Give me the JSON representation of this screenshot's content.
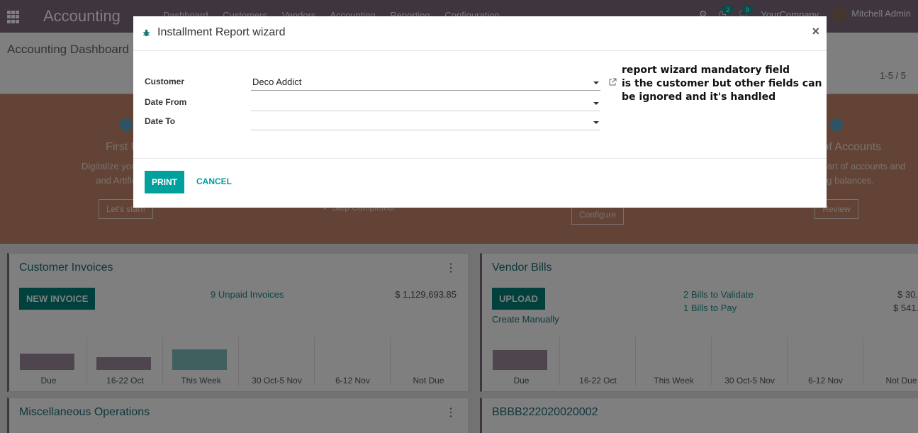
{
  "app": {
    "title": "Accounting",
    "menu": [
      "Dashboard",
      "Customers",
      "Vendors",
      "Accounting",
      "Reporting",
      "Configuration"
    ],
    "activity_count": "2",
    "message_count": "9",
    "company": "YourCompany",
    "user": "Mitchell Admin"
  },
  "control_panel": {
    "breadcrumb": "Accounting Dashboard",
    "pager": "1-5 / 5"
  },
  "onboarding": {
    "steps": [
      {
        "title": "First Bill",
        "desc1": "Digitalize your vendor",
        "desc2": "and Artificial In",
        "button": "Let's start!"
      },
      {
        "title": "",
        "desc1": "",
        "desc2": "",
        "button": "Configure"
      },
      {
        "title": "Chart of Accounts",
        "desc1": "Set up your chart of accounts and",
        "desc2": "opening balances.",
        "button": "Review"
      }
    ],
    "completed": "✓ Step Completed!"
  },
  "cards": {
    "customer_invoices": {
      "title": "Customer Invoices",
      "button": "NEW INVOICE",
      "link": "9 Unpaid Invoices",
      "amount": "$ 1,129,693.85",
      "graph_labels": [
        "Due",
        "16-22 Oct",
        "This Week",
        "30 Oct-5 Nov",
        "6-12 Nov",
        "Not Due"
      ],
      "graph_values": [
        0.5,
        0.4,
        0.62,
        0,
        0,
        0
      ]
    },
    "vendor_bills": {
      "title": "Vendor Bills",
      "button": "UPLOAD",
      "create_manually": "Create Manually",
      "link1": "2 Bills to Validate",
      "link2": "1 Bills to Pay",
      "amount1": "$ 30.",
      "amount2": "$ 541.",
      "graph_labels": [
        "Due",
        "16-22 Oct",
        "This Week",
        "30 Oct-5 Nov",
        "6-12 Nov",
        "Not Due"
      ],
      "graph_values": [
        0.6,
        0,
        0,
        0,
        0,
        0
      ]
    },
    "misc": {
      "title": "Miscellaneous Operations"
    },
    "bbbb": {
      "title": "BBBB222020020002"
    }
  },
  "colors": {
    "accent": "#00a09d",
    "header": "#7c6a7c",
    "bar_purple": "#9e8a9e",
    "bar_teal": "#7fc1bd"
  },
  "wizard": {
    "title": "Installment Report wizard",
    "fields": [
      {
        "label": "Customer",
        "value": "Deco Addict"
      },
      {
        "label": "Date From",
        "value": ""
      },
      {
        "label": "Date To",
        "value": ""
      }
    ],
    "note": [
      "report wizard mandatory field",
      "is the customer but other fields can",
      "be ignored and it's handled"
    ],
    "print": "PRINT",
    "cancel": "CANCEL",
    "close": "×"
  }
}
